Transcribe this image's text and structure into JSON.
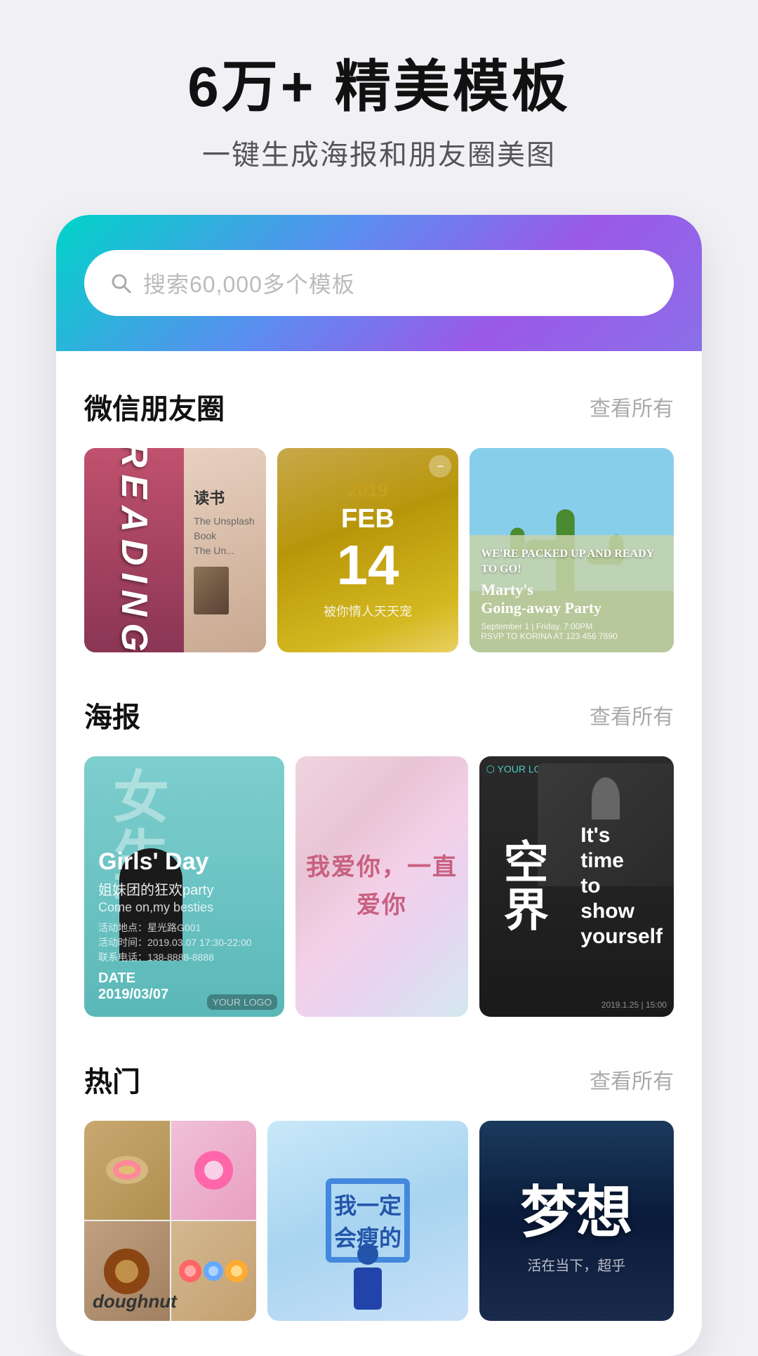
{
  "header": {
    "title": "6万+ 精美模板",
    "subtitle": "一键生成海报和朋友圈美图"
  },
  "search": {
    "placeholder": "搜索60,000多个模板"
  },
  "sections": [
    {
      "id": "wechat",
      "title": "微信朋友圈",
      "more_label": "查看所有",
      "cards": [
        {
          "id": "reading",
          "type": "reading",
          "text": "读书",
          "subtext": "READING"
        },
        {
          "id": "feb14",
          "type": "date",
          "year": "2019",
          "month": "FEB",
          "day": "14",
          "subtitle": "被你情人天天宠"
        },
        {
          "id": "cactus",
          "type": "cactus",
          "text": "Marty's Going-away Party"
        }
      ]
    },
    {
      "id": "poster",
      "title": "海报",
      "more_label": "查看所有",
      "cards": [
        {
          "id": "girls",
          "type": "girls",
          "big": "女生节",
          "title": "Girls' Day",
          "subtitle": "姐妹团的狂欢party",
          "tagline": "Come on,my besties",
          "date": "2019/03/07"
        },
        {
          "id": "love",
          "type": "love",
          "text": "我爱你，一直爱你"
        },
        {
          "id": "space",
          "type": "space",
          "vert": "空界",
          "lines": [
            "It's",
            "time",
            "to",
            "show",
            "yourself"
          ]
        }
      ]
    },
    {
      "id": "hot",
      "title": "热门",
      "more_label": "查看所有",
      "cards": [
        {
          "id": "doughnut",
          "type": "doughnut",
          "label": "doughnut"
        },
        {
          "id": "motivation",
          "type": "motivation",
          "text": "我一定会瘦的"
        },
        {
          "id": "dream",
          "type": "dream",
          "title": "梦想",
          "subtitle": "活在当下，超乎"
        }
      ]
    }
  ]
}
